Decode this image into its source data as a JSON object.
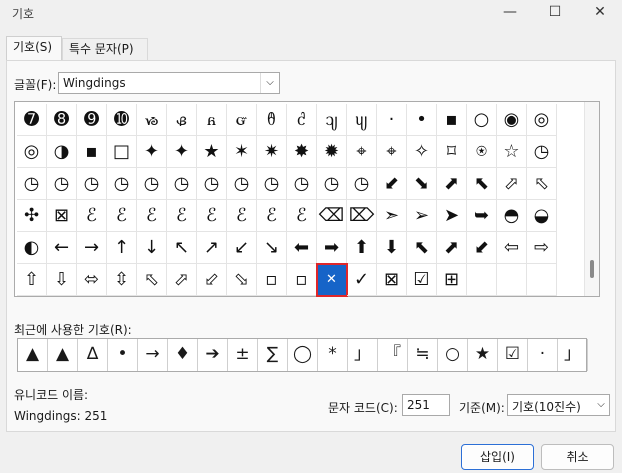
{
  "window": {
    "title": "기호",
    "minimize_glyph": "—",
    "maximize_glyph": "☐",
    "close_glyph": "✕"
  },
  "tabs": [
    {
      "label": "기호(S)"
    },
    {
      "label": "특수 문자(P)"
    }
  ],
  "font": {
    "label": "글꼴(F):",
    "value": "Wingdings",
    "dropdown_glyph": "⌵"
  },
  "grid": {
    "rows": [
      [
        "➐",
        "➑",
        "➒",
        "➓",
        "ᏹ",
        "ᏸ",
        "ᏺ",
        "ᏻ",
        "ᦹ",
        "ᦺ",
        "ᦻ",
        "ᦼ",
        "·",
        "•",
        "▪",
        "○",
        "◉",
        "◎"
      ],
      [
        "◎",
        "◑",
        "▪",
        "□",
        "✦",
        "✦",
        "★",
        "✶",
        "✷",
        "✸",
        "✹",
        "⌖",
        "⌖",
        "✧",
        "⌑",
        "⍟",
        "☆",
        "◷"
      ],
      [
        "◷",
        "◷",
        "◷",
        "◷",
        "◷",
        "◷",
        "◷",
        "◷",
        "◷",
        "◷",
        "◷",
        "◷",
        "⬋",
        "⬊",
        "⬈",
        "⬉",
        "⬀",
        "⬁"
      ],
      [
        "✣",
        "⊠",
        "ℰ",
        "ℰ",
        "ℰ",
        "ℰ",
        "ℰ",
        "ℰ",
        "ℰ",
        "ℰ",
        "⌫",
        "⌦",
        "➣",
        "➢",
        "➤",
        "➥",
        "◓",
        "◒"
      ],
      [
        "◐",
        "←",
        "→",
        "↑",
        "↓",
        "↖",
        "↗",
        "↙",
        "↘",
        "⬅",
        "➡",
        "⬆",
        "⬇",
        "⬉",
        "⬈",
        "⬋",
        "⇦",
        "⇨"
      ],
      [
        "⇧",
        "⇩",
        "⬄",
        "⇳",
        "⬁",
        "⬀",
        "⬃",
        "⬂",
        "▫",
        "▫",
        "✕",
        "✓",
        "⊠",
        "☑",
        "⊞",
        "",
        "",
        ""
      ]
    ],
    "selected": {
      "row": 5,
      "col": 10
    }
  },
  "recent": {
    "label": "최근에 사용한 기호(R):",
    "items": [
      "▲",
      "▲",
      "∆",
      "•",
      "→",
      "♦",
      "➔",
      "±",
      "∑",
      "◯",
      "*",
      "」",
      "『",
      "≒",
      "○",
      "★",
      "☑",
      "·",
      "」"
    ]
  },
  "unicode": {
    "label": "유니코드 이름:",
    "value": "Wingdings: 251"
  },
  "char_code": {
    "label": "문자 코드(C):",
    "value": "251"
  },
  "base": {
    "label": "기준(M):",
    "value": "기호(10진수)",
    "dropdown_glyph": "⌵"
  },
  "buttons": {
    "insert": "삽입(I)",
    "cancel": "취소"
  }
}
